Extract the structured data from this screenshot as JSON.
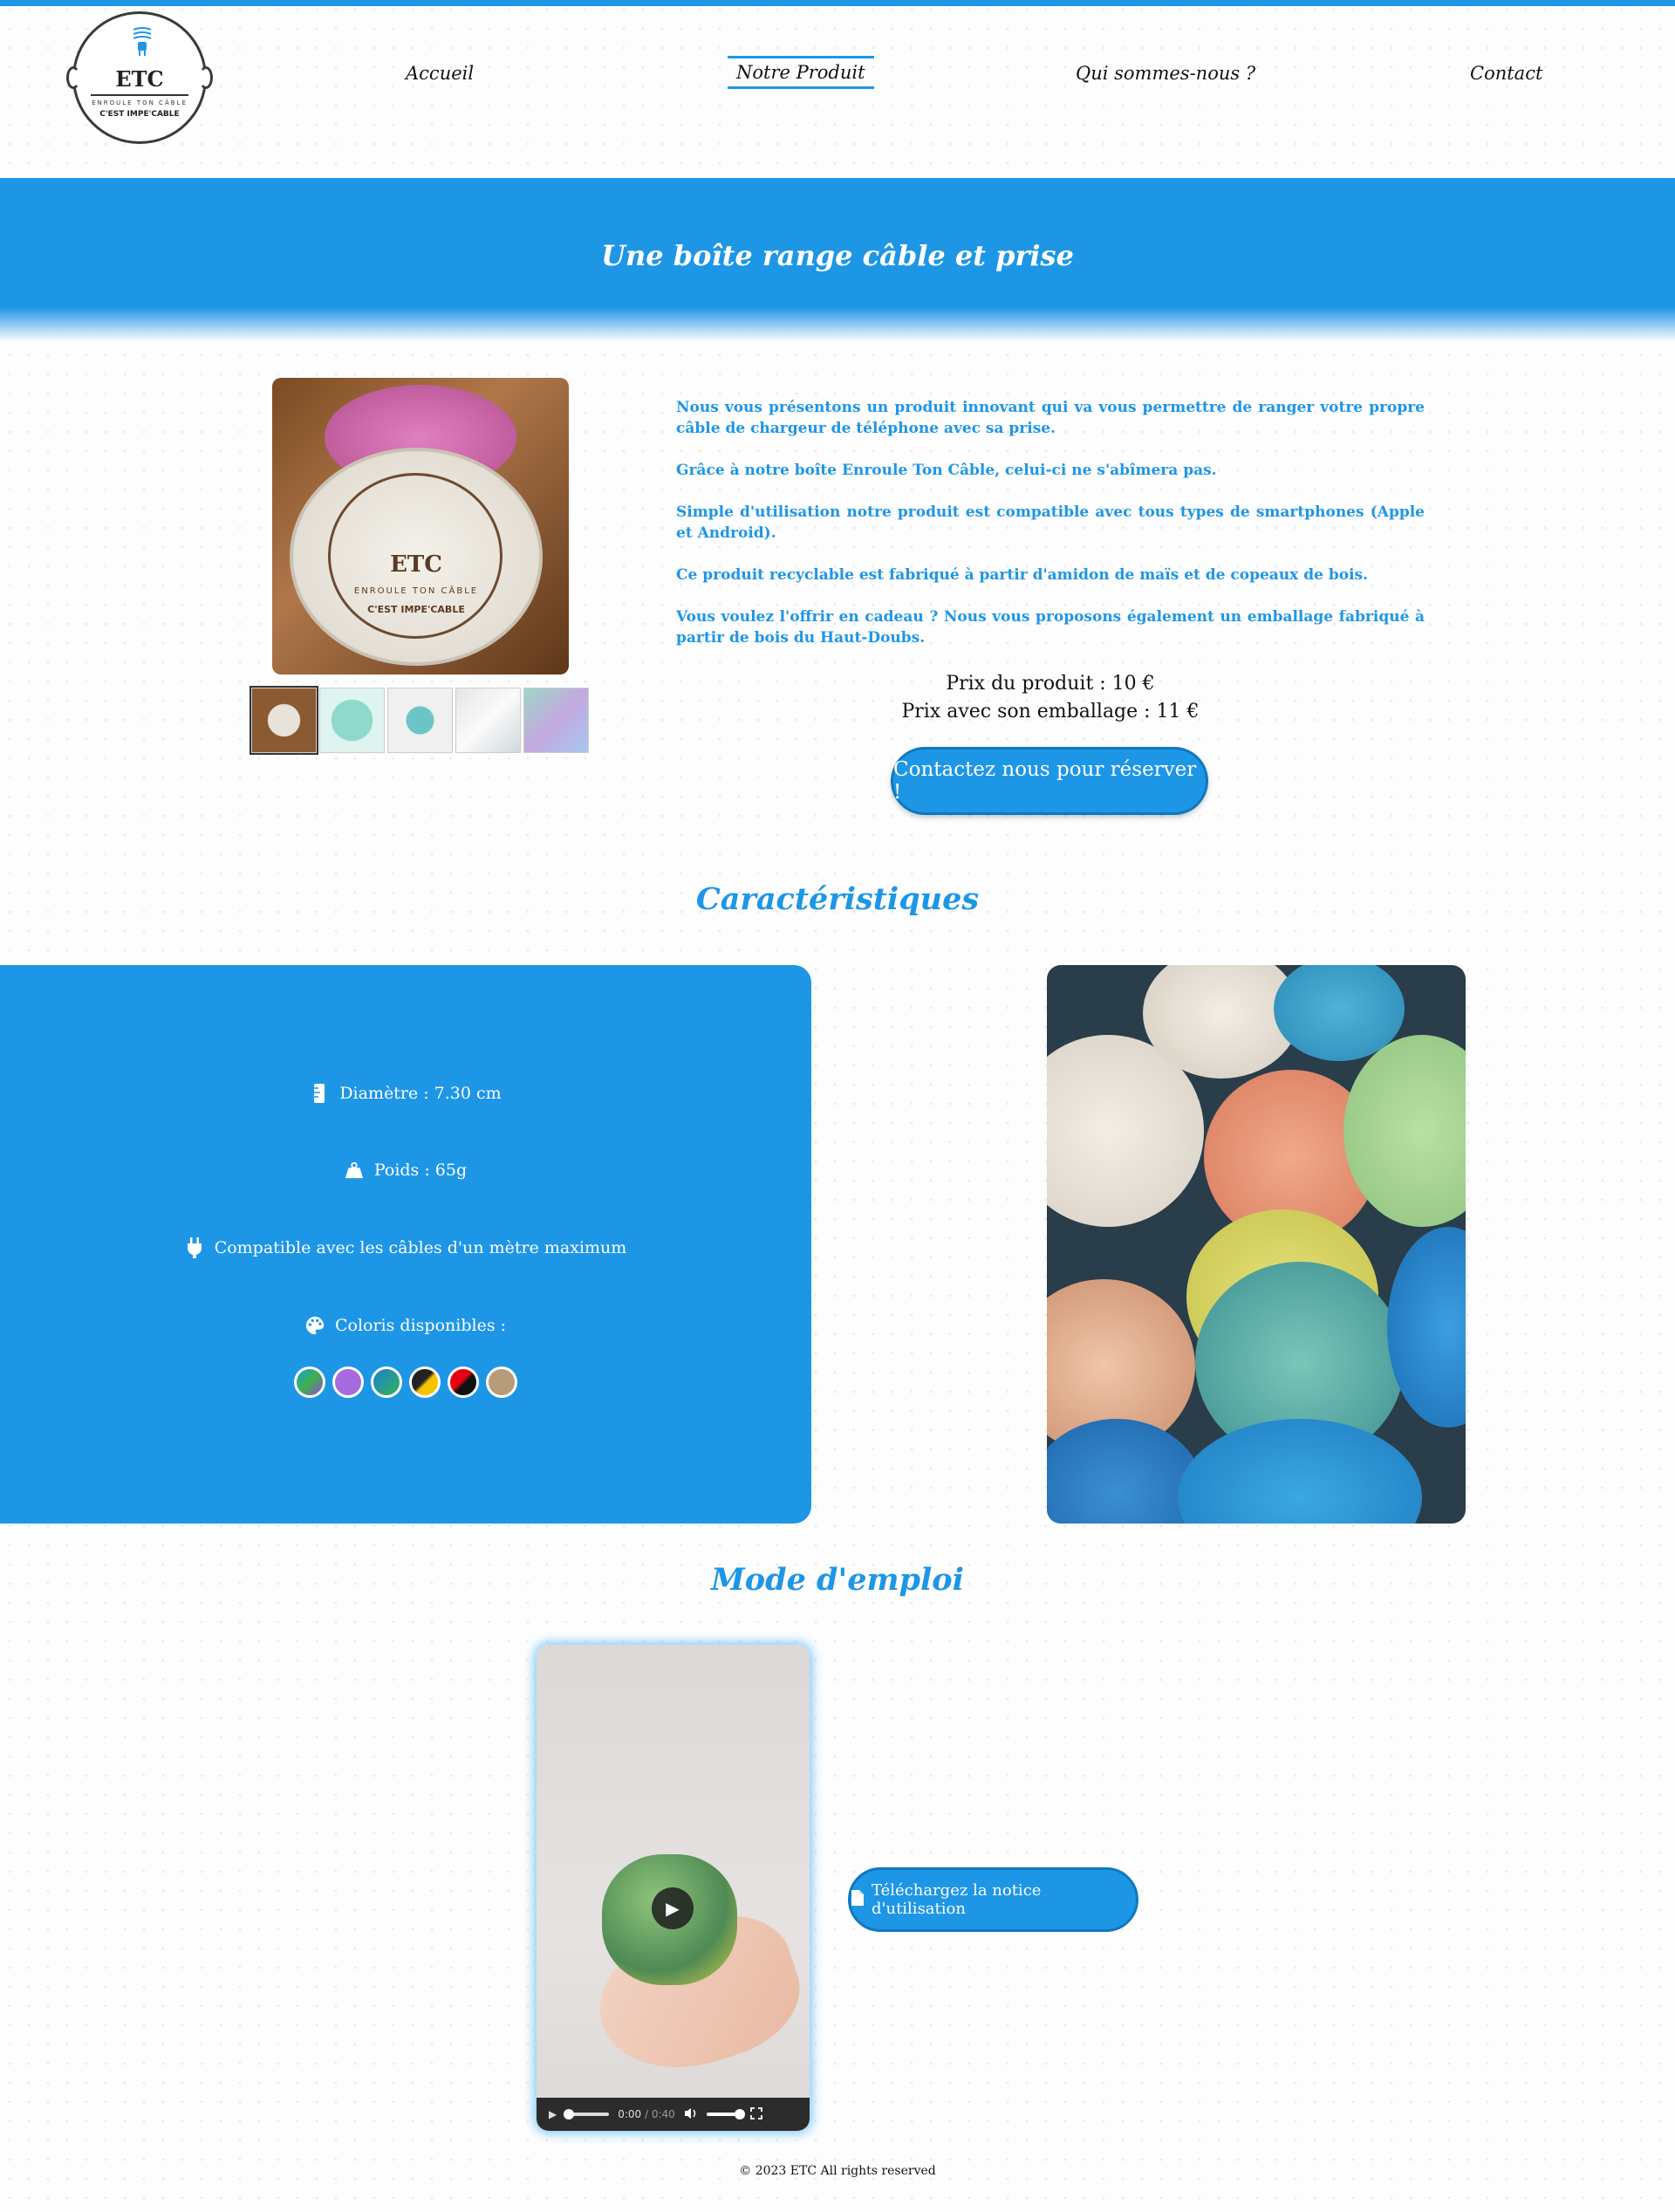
{
  "header": {
    "logo": {
      "title": "ETC",
      "subtitle": "ENROULE TON CÂBLE",
      "tagline": "C'EST IMPE'CABLE"
    },
    "nav": [
      {
        "label": "Accueil",
        "active": false
      },
      {
        "label": "Notre Produit",
        "active": true
      },
      {
        "label": "Qui sommes-nous ?",
        "active": false
      },
      {
        "label": "Contact",
        "active": false
      }
    ]
  },
  "hero": {
    "title": "Une boîte range câble et prise"
  },
  "product": {
    "photo_disc_title": "ETC",
    "photo_disc_sub": "ENROULE TON CÂBLE",
    "photo_disc_tagline": "C'EST IMPE'CABLE",
    "description": [
      "Nous vous présentons un produit innovant qui va vous permettre de ranger votre propre câble de chargeur de téléphone avec sa prise.",
      "Grâce à notre boîte Enroule Ton Câble, celui-ci ne s'abîmera pas.",
      "Simple d'utilisation notre produit est compatible avec tous types de smartphones (Apple et Android).",
      "Ce produit recyclable est fabriqué à partir d'amidon de maïs et de copeaux de bois.",
      "Vous voulez l'offrir en cadeau ? Nous vous proposons également un emballage fabriqué à partir de bois du Haut-Doubs."
    ],
    "price_line1": "Prix du produit : 10 €",
    "price_line2": "Prix avec son emballage : 11 €",
    "reserve_button": "Contactez nous pour réserver !"
  },
  "characteristics": {
    "title": "Caractéristiques",
    "diameter": "Diamètre : 7.30 cm",
    "weight": "Poids : 65g",
    "compat": "Compatible avec les câbles d'un mètre maximum",
    "colors_label": "Coloris disponibles :",
    "icons": [
      "ruler-icon",
      "weight-icon",
      "plug-icon",
      "palette-icon"
    ],
    "swatches": [
      "linear-gradient(135deg,#1e9be0 0%,#3fb04a 50%,#8a4bd6 100%)",
      "#a66bdf",
      "linear-gradient(135deg,#1a7fd0 0%,#36b35a 100%)",
      "linear-gradient(135deg,#222 0%,#222 45%,#f5c400 55%,#f5c400 100%)",
      "linear-gradient(135deg,#e60012 0%,#e60012 45%,#111 55%,#111 100%)",
      "#b89c7a"
    ]
  },
  "manual": {
    "title": "Mode d'emploi",
    "video_time": "0:00",
    "video_duration": "/ 0:40",
    "download_button": "Téléchargez la notice d'utilisation"
  },
  "footer": {
    "text": "© 2023 ETC All rights reserved"
  },
  "colors": {
    "accent": "#1e96e6",
    "accent_dark": "#0e78c2"
  }
}
